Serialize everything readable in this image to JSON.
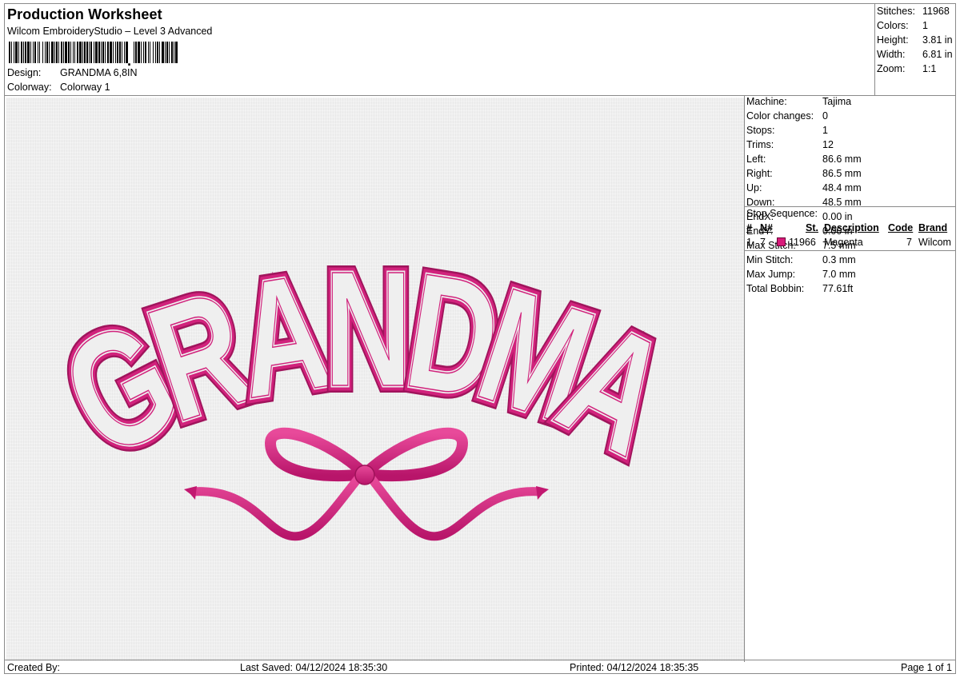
{
  "header": {
    "title": "Production Worksheet",
    "subtitle": "Wilcom EmbroideryStudio – Level 3 Advanced",
    "design_label": "Design:",
    "design_value": "GRANDMA 6,8IN",
    "colorway_label": "Colorway:",
    "colorway_value": "Colorway 1"
  },
  "summary": [
    {
      "label": "Stitches:",
      "value": "11968"
    },
    {
      "label": "Colors:",
      "value": "1"
    },
    {
      "label": "Height:",
      "value": "3.81 in"
    },
    {
      "label": "Width:",
      "value": "6.81 in"
    },
    {
      "label": "Zoom:",
      "value": "1:1"
    }
  ],
  "machine_info": [
    {
      "label": "Machine:",
      "value": "Tajima"
    },
    {
      "label": "Color changes:",
      "value": "0"
    },
    {
      "label": "Stops:",
      "value": "1"
    },
    {
      "label": "Trims:",
      "value": "12"
    },
    {
      "label": "Left:",
      "value": "86.6 mm"
    },
    {
      "label": "Right:",
      "value": "86.5 mm"
    },
    {
      "label": "Up:",
      "value": "48.4 mm"
    },
    {
      "label": "Down:",
      "value": "48.5 mm"
    },
    {
      "label": "EndX:",
      "value": "0.00 in"
    },
    {
      "label": "EndY:",
      "value": "0.00 in"
    },
    {
      "label": "Max Stitch:",
      "value": "7.5 mm"
    },
    {
      "label": "Min Stitch:",
      "value": "0.3 mm"
    },
    {
      "label": "Max Jump:",
      "value": "7.0 mm"
    },
    {
      "label": "Total Bobbin:",
      "value": "77.61ft"
    }
  ],
  "stop_sequence": {
    "label": "Stop Sequence:",
    "columns": [
      "#",
      "N#",
      "St.",
      "Description",
      "Code",
      "Brand"
    ],
    "rows": [
      {
        "index": "1.",
        "needle": "7",
        "stitches": "11966",
        "description": "Magenta",
        "code": "7",
        "brand": "Wilcom",
        "color": "#d81a7a"
      }
    ]
  },
  "design": {
    "text": "GRANDMA",
    "thread_color": "#d1227c",
    "thread_dark": "#a0145c",
    "fabric_color": "#efefef"
  },
  "footer": {
    "created": "Created By:",
    "saved": "Last Saved: 04/12/2024 18:35:30",
    "printed": "Printed: 04/12/2024 18:35:35",
    "page": "Page 1 of 1"
  }
}
